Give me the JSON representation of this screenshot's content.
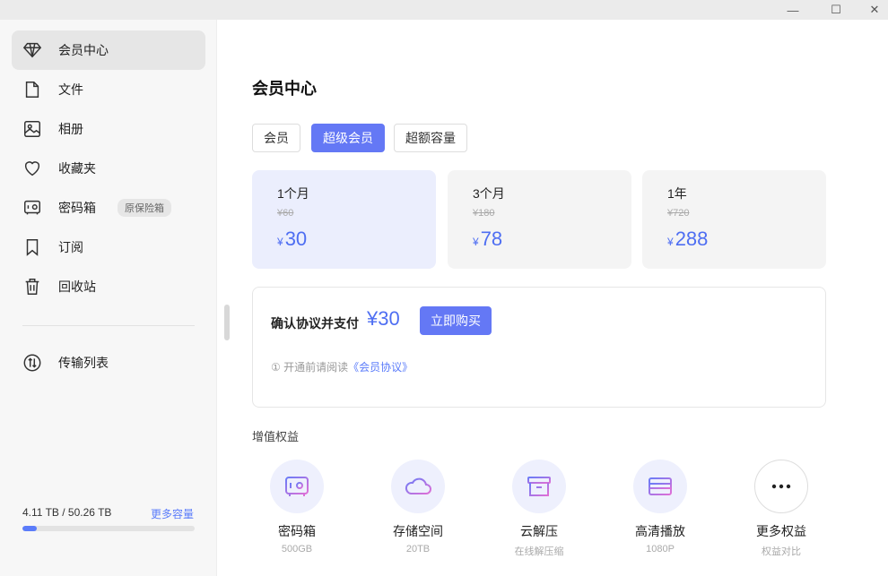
{
  "window": {
    "minimize": "—",
    "maximize": "☐",
    "close": "✕"
  },
  "sidebar": {
    "items": [
      {
        "label": "会员中心",
        "icon": "diamond-icon"
      },
      {
        "label": "文件",
        "icon": "file-icon"
      },
      {
        "label": "相册",
        "icon": "photo-icon"
      },
      {
        "label": "收藏夹",
        "icon": "heart-icon"
      },
      {
        "label": "密码箱",
        "icon": "safe-icon",
        "badge": "原保险箱"
      },
      {
        "label": "订阅",
        "icon": "bookmark-icon"
      },
      {
        "label": "回收站",
        "icon": "trash-icon"
      },
      {
        "label": "传输列表",
        "icon": "transfer-icon"
      }
    ],
    "storage": {
      "text": "4.11 TB / 50.26 TB",
      "more": "更多容量",
      "used_fraction": 0.082
    }
  },
  "main": {
    "title": "会员中心",
    "tabs": [
      "会员",
      "超级会员",
      "超额容量"
    ],
    "plans": [
      {
        "name": "1个月",
        "original": "¥60",
        "currency": "¥",
        "price": "30"
      },
      {
        "name": "3个月",
        "original": "¥180",
        "currency": "¥",
        "price": "78"
      },
      {
        "name": "1年",
        "original": "¥720",
        "currency": "¥",
        "price": "288"
      }
    ],
    "payment": {
      "label": "确认协议并支付",
      "price": "¥30",
      "button": "立即购买",
      "notice_icon": "①",
      "notice_text": "开通前请阅读",
      "notice_link": "《会员协议》"
    },
    "benefits_title": "增值权益",
    "benefits": [
      {
        "name": "密码箱",
        "sub": "500GB",
        "icon": "safe-icon"
      },
      {
        "name": "存储空间",
        "sub": "20TB",
        "icon": "cloud-icon"
      },
      {
        "name": "云解压",
        "sub": "在线解压缩",
        "icon": "archive-icon"
      },
      {
        "name": "高清播放",
        "sub": "1080P",
        "icon": "video-card-icon"
      },
      {
        "name": "更多权益",
        "sub": "权益对比",
        "icon": "more-icon"
      }
    ]
  },
  "colors": {
    "accent": "#6478f5",
    "price": "#4e6ef2",
    "sidebar_bg": "#f7f7f7"
  }
}
